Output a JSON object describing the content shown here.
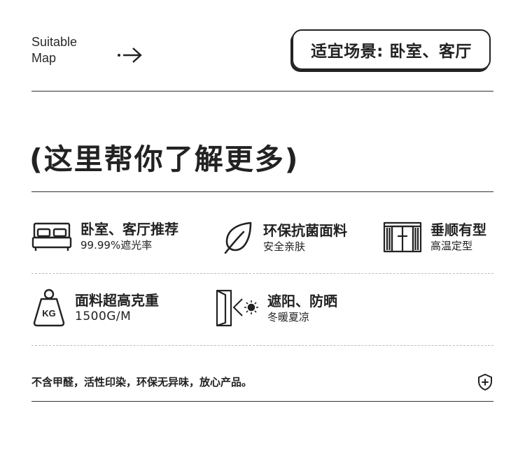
{
  "header": {
    "suitable_line1": "Suitable",
    "suitable_line2": "Map",
    "scene_label": "适宜场景: 卧室、客厅"
  },
  "headline": "(这里帮你了解更多)",
  "features": [
    {
      "icon": "bed-icon",
      "title": "卧室、客厅推荐",
      "subtitle": "99.99%遮光率"
    },
    {
      "icon": "leaf-icon",
      "title": "环保抗菌面料",
      "subtitle": "安全亲肤"
    },
    {
      "icon": "curtain-icon",
      "title": "垂顺有型",
      "subtitle": "高温定型"
    },
    {
      "icon": "weight-icon",
      "title": "面料超高克重",
      "subtitle": "1500G/M",
      "icon_text": "KG"
    },
    {
      "icon": "sun-door-icon",
      "title": "遮阳、防晒",
      "subtitle": "冬暖夏凉"
    }
  ],
  "footer_note": "不含甲醛，活性印染，环保无异味，放心产品。",
  "footer_icon": "shield-plus-icon"
}
